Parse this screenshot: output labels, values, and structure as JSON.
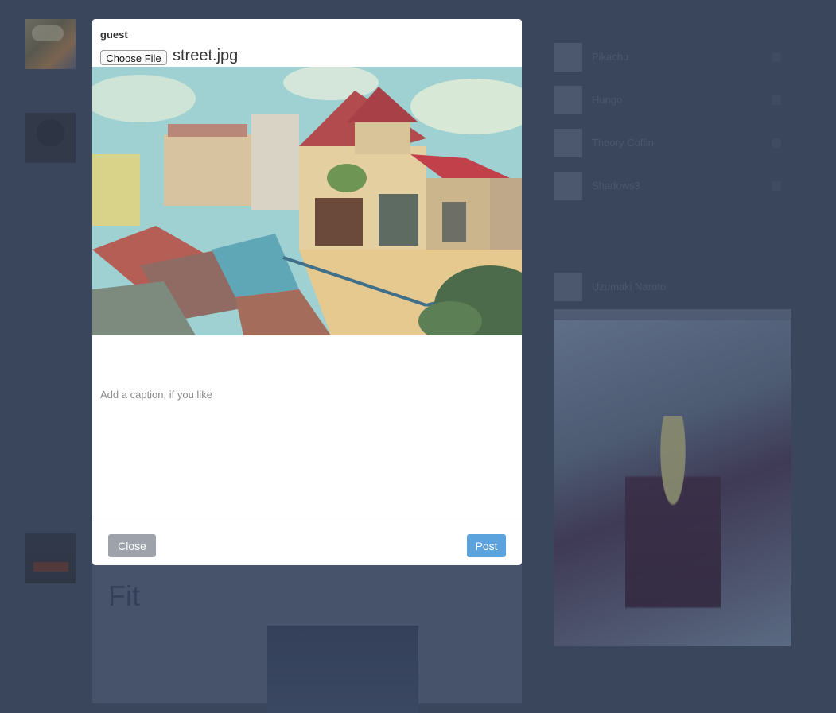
{
  "background": {
    "friends": [
      {
        "name": "Pikachu"
      },
      {
        "name": "Hungo"
      },
      {
        "name": "Theory Coffin"
      },
      {
        "name": "Shadows3"
      }
    ],
    "featured_user": "Uzumaki Naruto",
    "post_title": "Fit"
  },
  "modal": {
    "username": "guest",
    "file_button_label": "Choose File",
    "file_name": "street.jpg",
    "caption_placeholder": "Add a caption, if you like",
    "close_label": "Close",
    "post_label": "Post"
  },
  "colors": {
    "overlay": "#3a465c",
    "close_button": "#9ea3ab",
    "post_button": "#5aa3dc"
  }
}
